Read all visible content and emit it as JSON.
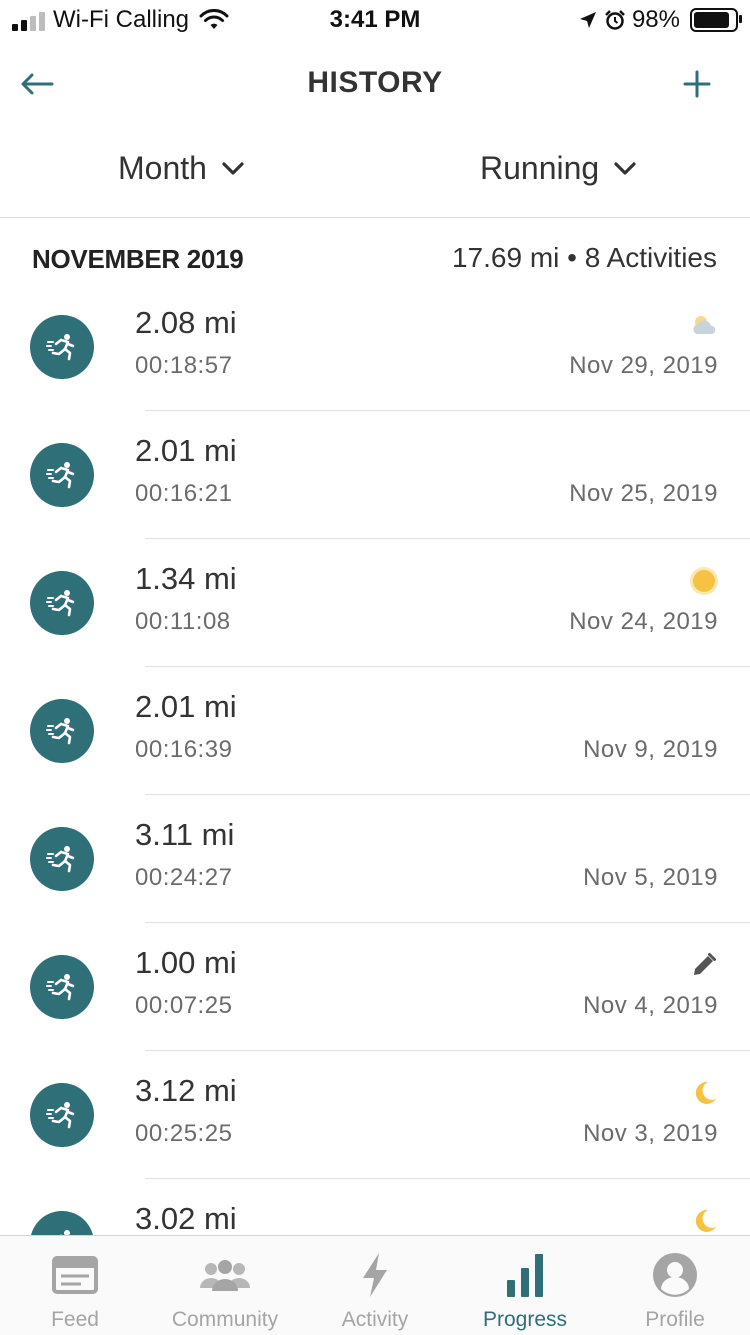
{
  "status_bar": {
    "carrier": "Wi-Fi Calling",
    "time": "3:41 PM",
    "battery": "98%",
    "battery_level": 0.98
  },
  "header": {
    "title": "HISTORY",
    "back_icon": "arrow-left-icon",
    "add_icon": "plus-icon"
  },
  "filters": {
    "period": "Month",
    "activity_type": "Running"
  },
  "month": {
    "title": "NOVEMBER 2019",
    "summary": "17.69 mi • 8 Activities"
  },
  "activities": [
    {
      "distance": "2.08 mi",
      "duration": "00:18:57",
      "date": "Nov 29, 2019",
      "badge": "cloud-sun-icon"
    },
    {
      "distance": "2.01 mi",
      "duration": "00:16:21",
      "date": "Nov 25, 2019",
      "badge": ""
    },
    {
      "distance": "1.34 mi",
      "duration": "00:11:08",
      "date": "Nov 24, 2019",
      "badge": "sun-icon"
    },
    {
      "distance": "2.01 mi",
      "duration": "00:16:39",
      "date": "Nov 9, 2019",
      "badge": ""
    },
    {
      "distance": "3.11 mi",
      "duration": "00:24:27",
      "date": "Nov 5, 2019",
      "badge": ""
    },
    {
      "distance": "1.00 mi",
      "duration": "00:07:25",
      "date": "Nov 4, 2019",
      "badge": "pencil-icon"
    },
    {
      "distance": "3.12 mi",
      "duration": "00:25:25",
      "date": "Nov 3, 2019",
      "badge": "moon-icon"
    },
    {
      "distance": "3.02 mi",
      "duration": "",
      "date": "",
      "badge": "moon-icon"
    }
  ],
  "tabbar": {
    "tabs": [
      {
        "label": "Feed",
        "icon": "feed-icon"
      },
      {
        "label": "Community",
        "icon": "community-icon"
      },
      {
        "label": "Activity",
        "icon": "lightning-icon"
      },
      {
        "label": "Progress",
        "icon": "bar-chart-icon"
      },
      {
        "label": "Profile",
        "icon": "profile-icon"
      }
    ],
    "active": "Progress"
  },
  "colors": {
    "accent": "#2f6f78",
    "sun": "#f6c244",
    "inactive_tab": "#a5a5a5",
    "divider": "#e2e2e2"
  }
}
